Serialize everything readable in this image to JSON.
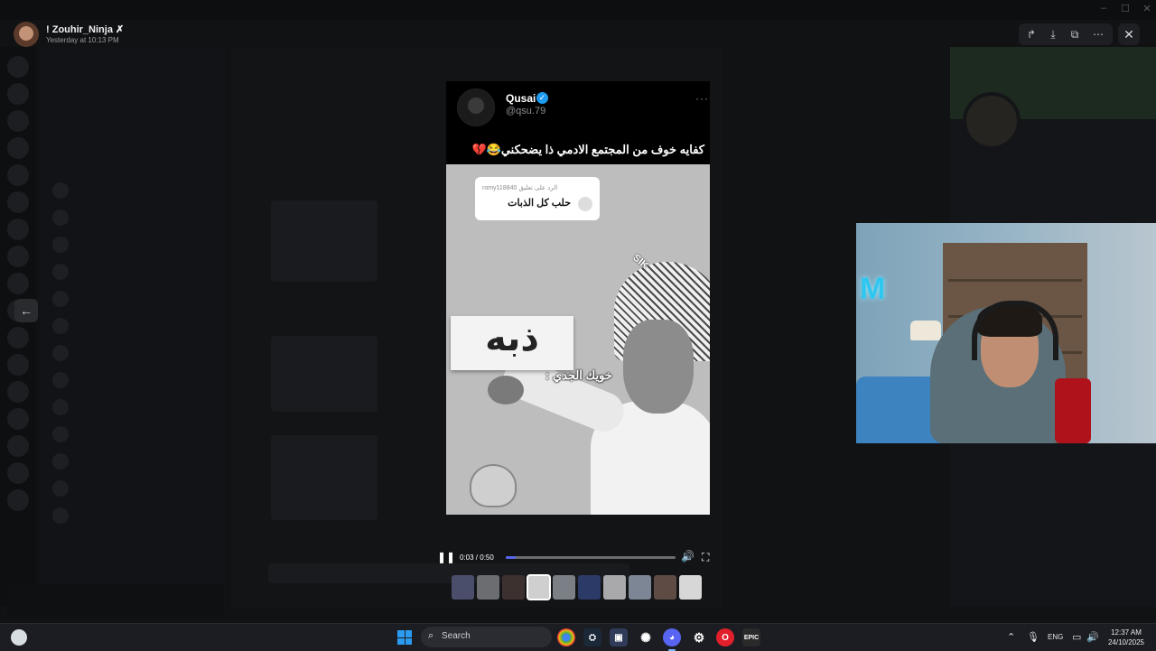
{
  "viewer": {
    "author_name": "! Zouhir_Ninja ✗",
    "timestamp": "Yesterday at 10:13 PM",
    "toolbar": {
      "forward_icon": "forward-arrow-icon",
      "download_icon": "download-icon",
      "open_external_icon": "open-external-icon",
      "more_icon": "more-dots-icon"
    },
    "close_icon": "close-icon",
    "prev_icon": "arrow-left-icon"
  },
  "post": {
    "author": "Qusai",
    "handle": "@qsu.79",
    "caption": "كفايه خوف من المجتمع الادمي ذا يضحكني😂💔",
    "media": {
      "comment_meta": "romy118840 الرد على تعليق",
      "comment_text": "حلب كل الذبات",
      "sign_text": "ذبه",
      "overlay_text": "خويك الجدي :",
      "watermark": "SIK"
    }
  },
  "player": {
    "time": "0:03 / 0:50",
    "progress": 0.06,
    "accent": "#5865f2",
    "play_state_icon": "pause-icon",
    "volume_icon": "volume-icon",
    "fullscreen_icon": "fullscreen-icon"
  },
  "thumbnails": [
    {
      "color": "#4a4e6a"
    },
    {
      "color": "#6c6d70"
    },
    {
      "color": "#3d3130"
    },
    {
      "color": "#cfcfcf",
      "active": true
    },
    {
      "color": "#7b7f86"
    },
    {
      "color": "#2b3a66"
    },
    {
      "color": "#a9a9ab"
    },
    {
      "color": "#7d8694"
    },
    {
      "color": "#5e4b44"
    },
    {
      "color": "#d7d7d7"
    }
  ],
  "taskbar": {
    "search_placeholder": "Search",
    "language": "ENG",
    "time": "12:37 AM",
    "date": "24/10/2025",
    "apps": [
      "chrome-icon",
      "steam-icon",
      "tool-icon",
      "chatgpt-icon",
      "discord-icon",
      "steam-alt-icon",
      "opera-icon",
      "epic-games-icon"
    ],
    "epic_label": "EPIC"
  }
}
